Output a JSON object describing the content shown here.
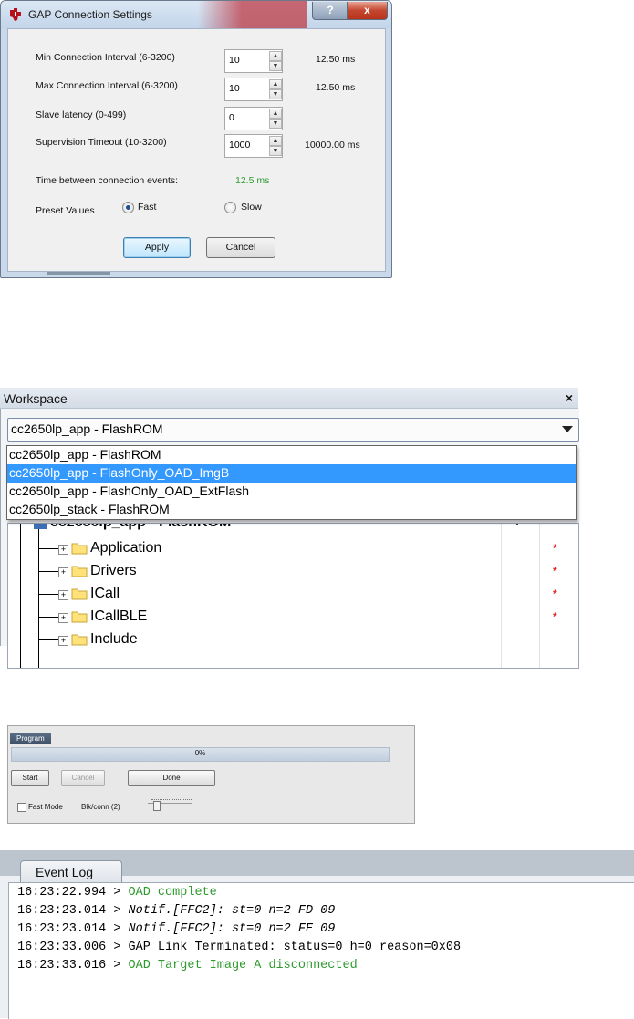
{
  "gap_dialog": {
    "title": "GAP Connection Settings",
    "help_button": "?",
    "close_button": "x",
    "fields": [
      {
        "label": "Min Connection Interval (6-3200)",
        "value": "10",
        "result": "12.50 ms"
      },
      {
        "label": "Max Connection Interval (6-3200)",
        "value": "10",
        "result": "12.50 ms"
      },
      {
        "label": "Slave latency (0-499)",
        "value": "0",
        "result": ""
      },
      {
        "label": "Supervision Timeout (10-3200)",
        "value": "1000",
        "result": "10000.00 ms"
      }
    ],
    "time_between_label": "Time between connection events:",
    "time_between_value": "12.5 ms",
    "preset_label": "Preset Values",
    "preset_fast": "Fast",
    "preset_slow": "Slow",
    "preset_selected": "Fast",
    "apply_button": "Apply",
    "cancel_button": "Cancel"
  },
  "workspace": {
    "title": "Workspace",
    "close": "×",
    "selected_config": "cc2650lp_app - FlashROM",
    "options": [
      "cc2650lp_app - FlashROM",
      "cc2650lp_app - FlashOnly_OAD_ImgB",
      "cc2650lp_app - FlashOnly_OAD_ExtFlash",
      "cc2650lp_stack - FlashROM"
    ],
    "highlighted_option_index": 1,
    "tree_items": [
      {
        "name": "Application",
        "modified": "*"
      },
      {
        "name": "Drivers",
        "modified": "*"
      },
      {
        "name": "ICall",
        "modified": "*"
      },
      {
        "name": "ICallBLE",
        "modified": "*"
      },
      {
        "name": "Include",
        "modified": ""
      }
    ]
  },
  "program": {
    "title": "Program",
    "progress_text": "0%",
    "progress": 0,
    "start_button": "Start",
    "cancel_button": "Cancel",
    "done_button": "Done",
    "fast_mode_label": "Fast Mode",
    "blk_conn_label": "Blk/conn (2)"
  },
  "event_log": {
    "title": "Event Log",
    "lines": [
      {
        "time": "16:23:22.994",
        "sep": " > ",
        "text": "OAD complete",
        "style": "green"
      },
      {
        "time": "16:23:23.014",
        "sep": " > ",
        "text": "Notif.[FFC2]: st=0 n=2 FD 09",
        "style": "italic"
      },
      {
        "time": "16:23:23.014",
        "sep": " > ",
        "text": "Notif.[FFC2]: st=0 n=2 FE 09",
        "style": "italic"
      },
      {
        "time": "16:23:33.006",
        "sep": " > ",
        "text": "GAP Link Terminated: status=0 h=0 reason=0x08",
        "style": "plain"
      },
      {
        "time": "16:23:33.016",
        "sep": " > ",
        "text": "OAD Target Image A disconnected",
        "style": "green"
      }
    ]
  },
  "colors": {
    "accent_green": "#2c9a2c",
    "selection_blue": "#3399ff",
    "modified_star": "#e3252b"
  }
}
